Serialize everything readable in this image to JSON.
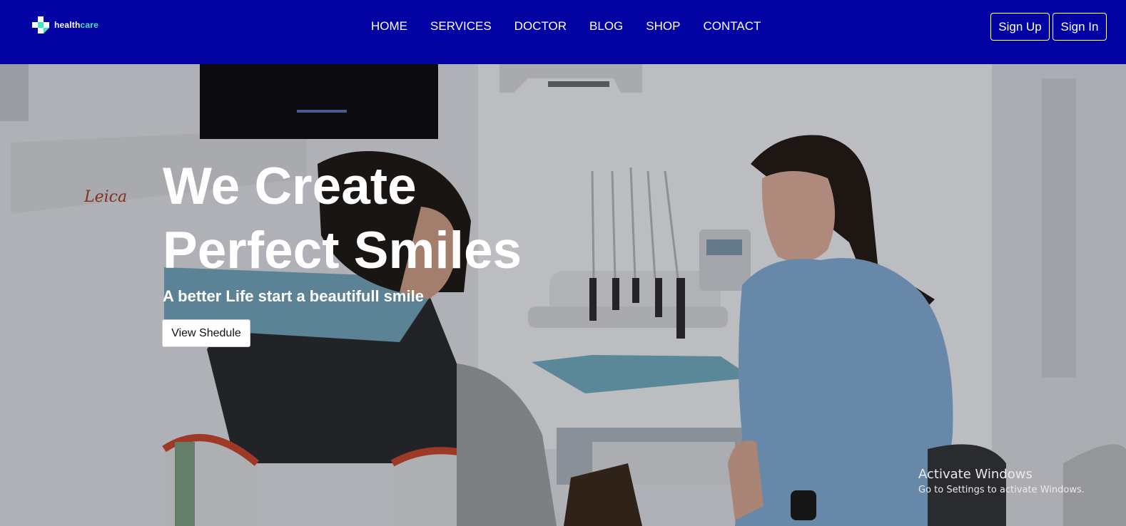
{
  "brand": {
    "name_part1": "health",
    "name_part2": "care",
    "icon": "medical-cross-icon",
    "accent_color": "#3ee6c2"
  },
  "nav": {
    "items": [
      {
        "label": "HOME"
      },
      {
        "label": "SERVICES"
      },
      {
        "label": "DOCTOR"
      },
      {
        "label": "BLOG"
      },
      {
        "label": "SHOP"
      },
      {
        "label": "CONTACT"
      }
    ]
  },
  "auth": {
    "signup_label": "Sign Up",
    "signin_label": "Sign In"
  },
  "hero": {
    "title_line1": "We Create",
    "title_line2": "Perfect Smiles",
    "subtitle": "A better Life start a beautifull smile",
    "cta_label": "View Shedule",
    "image_watermark": "Leica"
  },
  "os_overlay": {
    "title": "Activate Windows",
    "subtitle": "Go to Settings to activate Windows."
  },
  "colors": {
    "header_bg": "#0303a3",
    "text": "#ffffff"
  }
}
